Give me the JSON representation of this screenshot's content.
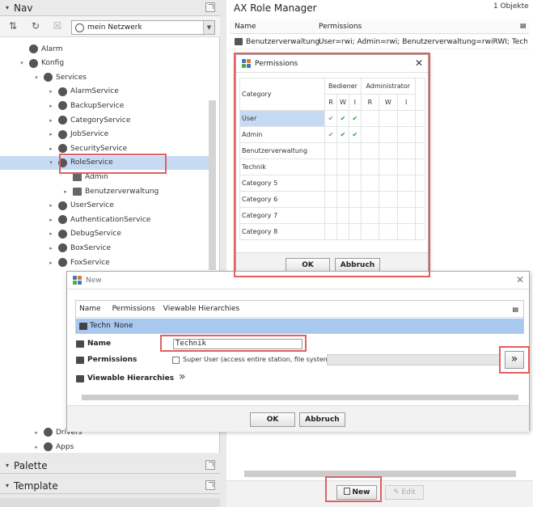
{
  "nav": {
    "title": "Nav",
    "station": "mein Netzwerk",
    "tree": [
      {
        "label": "Alarm",
        "indent": 2,
        "arrow": ""
      },
      {
        "label": "Konfig",
        "indent": 2,
        "arrow": "▾"
      },
      {
        "label": "Services",
        "indent": 3,
        "arrow": "▾"
      },
      {
        "label": "AlarmService",
        "indent": 4,
        "arrow": "▸"
      },
      {
        "label": "BackupService",
        "indent": 4,
        "arrow": "▸"
      },
      {
        "label": "CategoryService",
        "indent": 4,
        "arrow": "▸"
      },
      {
        "label": "JobService",
        "indent": 4,
        "arrow": "▸"
      },
      {
        "label": "SecurityService",
        "indent": 4,
        "arrow": "▸"
      },
      {
        "label": "RoleService",
        "indent": 4,
        "arrow": "▾"
      },
      {
        "label": "Admin",
        "indent": 5,
        "arrow": ""
      },
      {
        "label": "Benutzerverwaltung",
        "indent": 5,
        "arrow": "▸"
      },
      {
        "label": "UserService",
        "indent": 4,
        "arrow": "▸"
      },
      {
        "label": "AuthenticationService",
        "indent": 4,
        "arrow": "▸"
      },
      {
        "label": "DebugService",
        "indent": 4,
        "arrow": "▸"
      },
      {
        "label": "BoxService",
        "indent": 4,
        "arrow": "▸"
      },
      {
        "label": "FoxService",
        "indent": 4,
        "arrow": "▸"
      }
    ],
    "tree_bottom": [
      {
        "label": "Drivers",
        "indent": 3,
        "arrow": "▸"
      },
      {
        "label": "Apps",
        "indent": 3,
        "arrow": "▸"
      }
    ]
  },
  "palette": {
    "title": "Palette"
  },
  "template": {
    "title": "Template"
  },
  "role_manager": {
    "title": "AX Role Manager",
    "count": "1 Objekte",
    "columns": [
      "Name",
      "Permissions"
    ],
    "row": {
      "name": "Benutzerverwaltung",
      "permissions": "User=rwi; Admin=rwi; Benutzerverwaltung=rwiRWI; Technik=rwi"
    },
    "new_label": "New",
    "edit_label": "Edit"
  },
  "permissions_dialog": {
    "title": "Permissions",
    "category_header": "Category",
    "groups": [
      "Bediener",
      "Administrator"
    ],
    "subcols": [
      "R",
      "W",
      "I",
      "R",
      "W",
      "I"
    ],
    "rows": [
      {
        "category": "User",
        "marks": [
          "grey",
          "green",
          "green",
          "",
          "",
          ""
        ]
      },
      {
        "category": "Admin",
        "marks": [
          "grey",
          "green",
          "green",
          "",
          "",
          ""
        ]
      },
      {
        "category": "Benutzerverwaltung",
        "marks": [
          "",
          "",
          "",
          "",
          "",
          ""
        ]
      },
      {
        "category": "Technik",
        "marks": [
          "",
          "",
          "",
          "",
          "",
          ""
        ]
      },
      {
        "category": "Category 5",
        "marks": [
          "",
          "",
          "",
          "",
          "",
          ""
        ]
      },
      {
        "category": "Category 6",
        "marks": [
          "",
          "",
          "",
          "",
          "",
          ""
        ]
      },
      {
        "category": "Category 7",
        "marks": [
          "",
          "",
          "",
          "",
          "",
          ""
        ]
      },
      {
        "category": "Category 8",
        "marks": [
          "",
          "",
          "",
          "",
          "",
          ""
        ]
      }
    ],
    "ok_label": "OK",
    "cancel_label": "Abbruch"
  },
  "new_dialog": {
    "title": "New",
    "columns": [
      "Name",
      "Permissions",
      "Viewable Hierarchies"
    ],
    "row_name": "Techn",
    "row_perm": "None",
    "name_label": "Name",
    "name_value": "Technik",
    "permissions_label": "Permissions",
    "superuser_label": "Super User (access entire station, file system)",
    "hierarchies_label": "Viewable Hierarchies",
    "ok_label": "OK",
    "cancel_label": "Abbruch"
  }
}
